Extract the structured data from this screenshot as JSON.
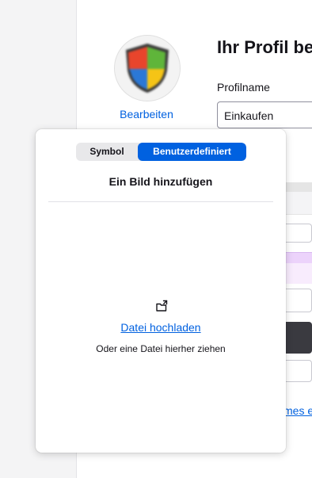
{
  "profile": {
    "title": "Ihr Profil be",
    "edit_label": "Bearbeiten",
    "name_label": "Profilname",
    "name_value": "Einkaufen",
    "partial_link": "mes e"
  },
  "popup": {
    "tabs": {
      "symbol": "Symbol",
      "custom": "Benutzerdefiniert",
      "selected": "custom"
    },
    "heading": "Ein Bild hinzufügen",
    "upload_link": "Datei hochladen",
    "drag_hint": "Oder eine Datei hierher ziehen",
    "upload_icon": "upload-file-icon"
  },
  "colors": {
    "accent": "#0061e0",
    "text": "#15141a"
  }
}
